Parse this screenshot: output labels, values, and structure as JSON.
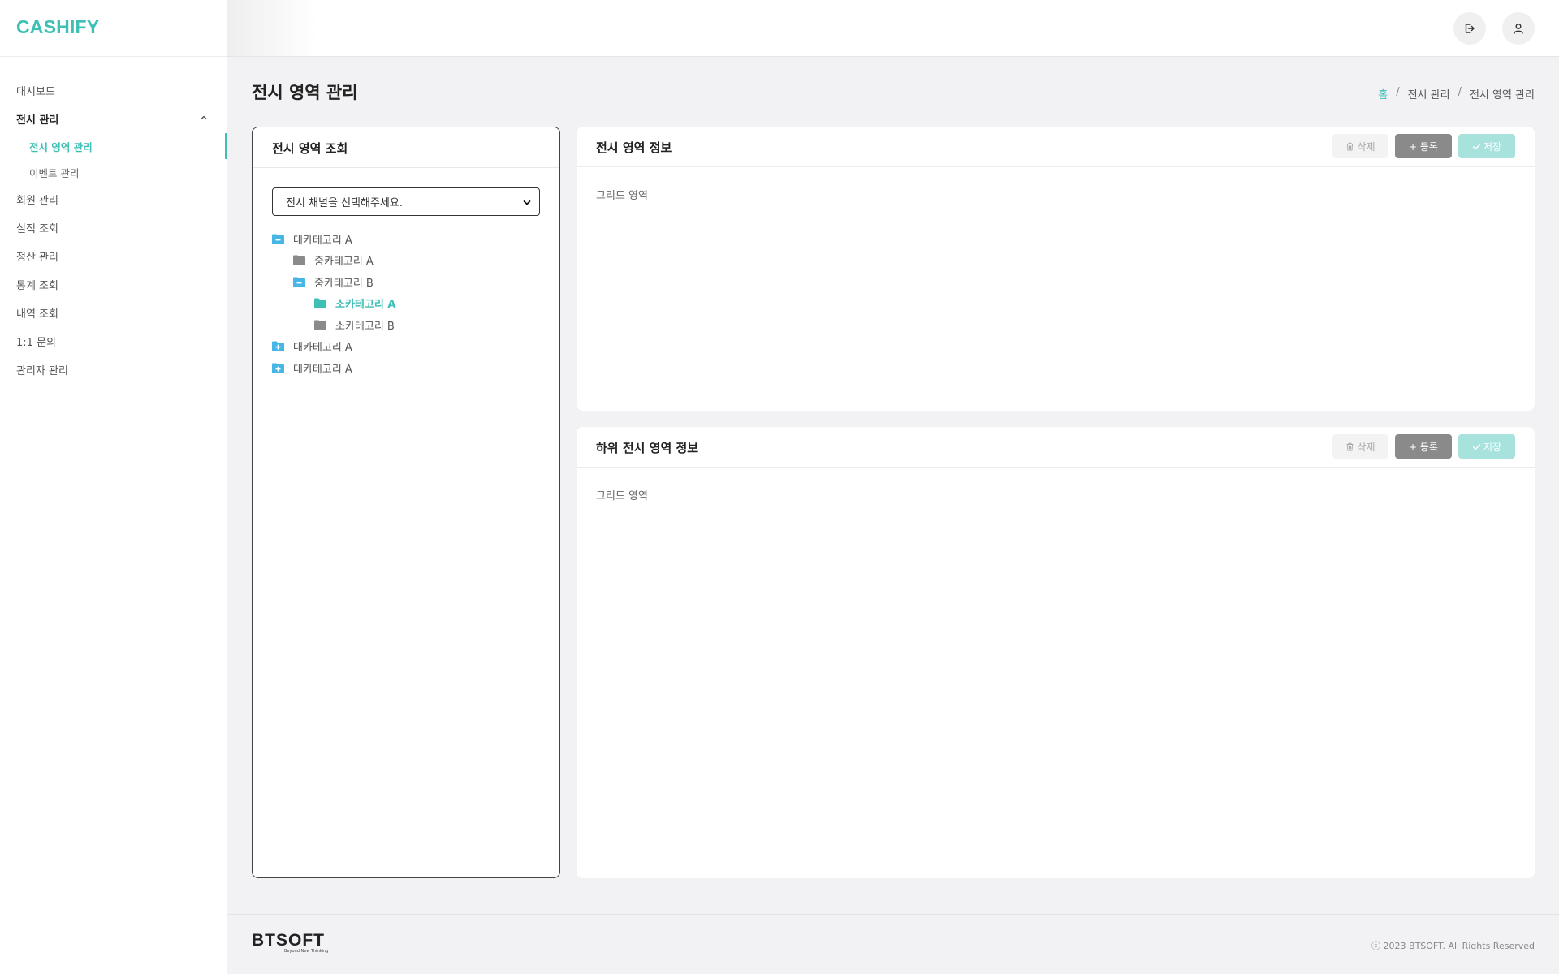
{
  "brand": "CASHIFY",
  "sidebar": {
    "items": [
      {
        "label": "대시보드"
      },
      {
        "label": "전시 관리"
      },
      {
        "label": "전시 영역 관리"
      },
      {
        "label": "이벤트 관리"
      },
      {
        "label": "회원 관리"
      },
      {
        "label": "실적 조회"
      },
      {
        "label": "정산 관리"
      },
      {
        "label": "통계 조회"
      },
      {
        "label": "내역 조회"
      },
      {
        "label": "1:1 문의"
      },
      {
        "label": "관리자 관리"
      }
    ]
  },
  "page": {
    "title": "전시 영역 관리",
    "breadcrumb": [
      "홈",
      "/",
      "전시 관리",
      "/",
      "전시 영역 관리"
    ]
  },
  "tree_panel": {
    "title": "전시 영역 조회",
    "select_value": "전시 채널을 선택해주세요.",
    "nodes": [
      {
        "label": "대카테고리 A",
        "icon": "folder-minus-icon"
      },
      {
        "label": "중카테고리 A",
        "icon": "folder-icon"
      },
      {
        "label": "중카테고리 B",
        "icon": "folder-minus-icon"
      },
      {
        "label": "소카테고리 A",
        "icon": "folder-icon"
      },
      {
        "label": "소카테고리 B",
        "icon": "folder-icon"
      },
      {
        "label": "대카테고리 A",
        "icon": "folder-plus-icon"
      },
      {
        "label": "대카테고리 A",
        "icon": "folder-plus-icon"
      }
    ]
  },
  "info_panel": {
    "title": "전시 영역 정보",
    "grid_text": "그리드 영역",
    "delete_label": "삭제",
    "add_label": "+ 등록",
    "save_label": "저장"
  },
  "sub_panel": {
    "title": "하위 전시 영역 정보",
    "grid_text": "그리드 영역",
    "delete_label": "삭제",
    "add_label": "+ 등록",
    "save_label": "저장"
  },
  "footer": {
    "logo_text": "BTSOFT",
    "logo_tagline": "Beyond New Thinking",
    "copyright": "ⓒ 2023 BTSOFT. All Rights Reserved"
  },
  "colors": {
    "accent": "#3fc0b5",
    "button_gray": "#8a8a8a",
    "button_save": "#a8e2dd"
  }
}
